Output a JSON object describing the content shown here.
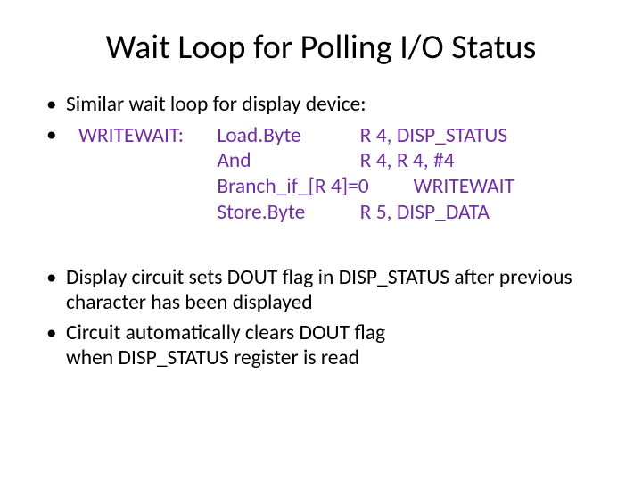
{
  "title": "Wait Loop for Polling I/O Status",
  "bullets": {
    "b1": "Similar wait loop for display device:",
    "b2": "",
    "b3": "Display circuit sets DOUT flag in DISP_STATUS after previous character has been displayed",
    "b4": "Circuit automatically clears DOUT flag",
    "b4_line2": "when DISP_STATUS register is read"
  },
  "code": {
    "label": "WRITEWAIT:",
    "r1_op": "Load.Byte",
    "r1_arg": "R 4, DISP_STATUS",
    "r2_op": "And",
    "r2_arg": "R 4, R 4, #4",
    "r3_op": "Branch_if_[R 4]=0",
    "r3_arg": "WRITEWAIT",
    "r4_op": "Store.Byte",
    "r4_arg": "R 5, DISP_DATA"
  }
}
